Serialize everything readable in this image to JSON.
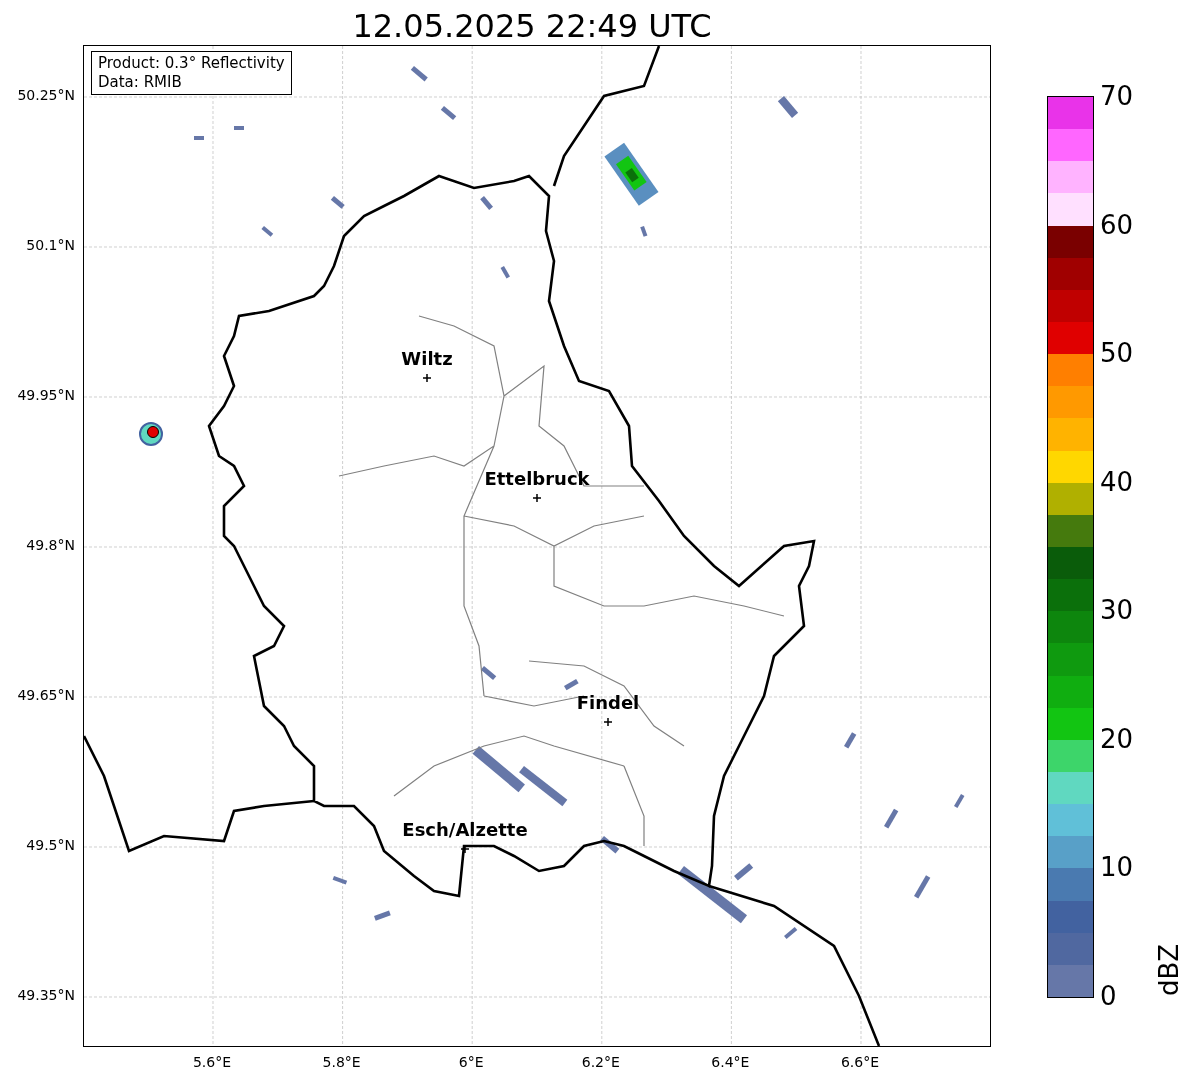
{
  "title": "12.05.2025 22:49 UTC",
  "legend": [
    "Product: 0.3° Reflectivity",
    "Data: RMIB"
  ],
  "cities": [
    {
      "name": "Wiltz"
    },
    {
      "name": "Ettelbruck"
    },
    {
      "name": "Findel"
    },
    {
      "name": "Esch/Alzette"
    }
  ],
  "x_ticks": [
    "5.6°E",
    "5.8°E",
    "6°E",
    "6.2°E",
    "6.4°E",
    "6.6°E"
  ],
  "y_ticks": [
    "50.25°N",
    "50.1°N",
    "49.95°N",
    "49.8°N",
    "49.65°N",
    "49.5°N",
    "49.35°N"
  ],
  "colorbar": {
    "label": "dBZ",
    "ticks": [
      "70",
      "60",
      "50",
      "40",
      "30",
      "20",
      "10",
      "0"
    ],
    "bins": [
      {
        "color": "#e933e9"
      },
      {
        "color": "#ff66ff"
      },
      {
        "color": "#ffb3ff"
      },
      {
        "color": "#ffe0ff"
      },
      {
        "color": "#7a0000"
      },
      {
        "color": "#a00000"
      },
      {
        "color": "#c00000"
      },
      {
        "color": "#e00000"
      },
      {
        "color": "#ff7f00"
      },
      {
        "color": "#ff9900"
      },
      {
        "color": "#ffb300"
      },
      {
        "color": "#ffd700"
      },
      {
        "color": "#b0b000"
      },
      {
        "color": "#457a0d"
      },
      {
        "color": "#0a5c0a"
      },
      {
        "color": "#0b700b"
      },
      {
        "color": "#0d860d"
      },
      {
        "color": "#0f9a0f"
      },
      {
        "color": "#10ae10"
      },
      {
        "color": "#12c512"
      },
      {
        "color": "#3dd56a"
      },
      {
        "color": "#60d8c0"
      },
      {
        "color": "#60c0d8"
      },
      {
        "color": "#58a0c8"
      },
      {
        "color": "#4a7ab0"
      },
      {
        "color": "#4262a0"
      },
      {
        "color": "#5068a0"
      },
      {
        "color": "#6677a8"
      }
    ]
  }
}
